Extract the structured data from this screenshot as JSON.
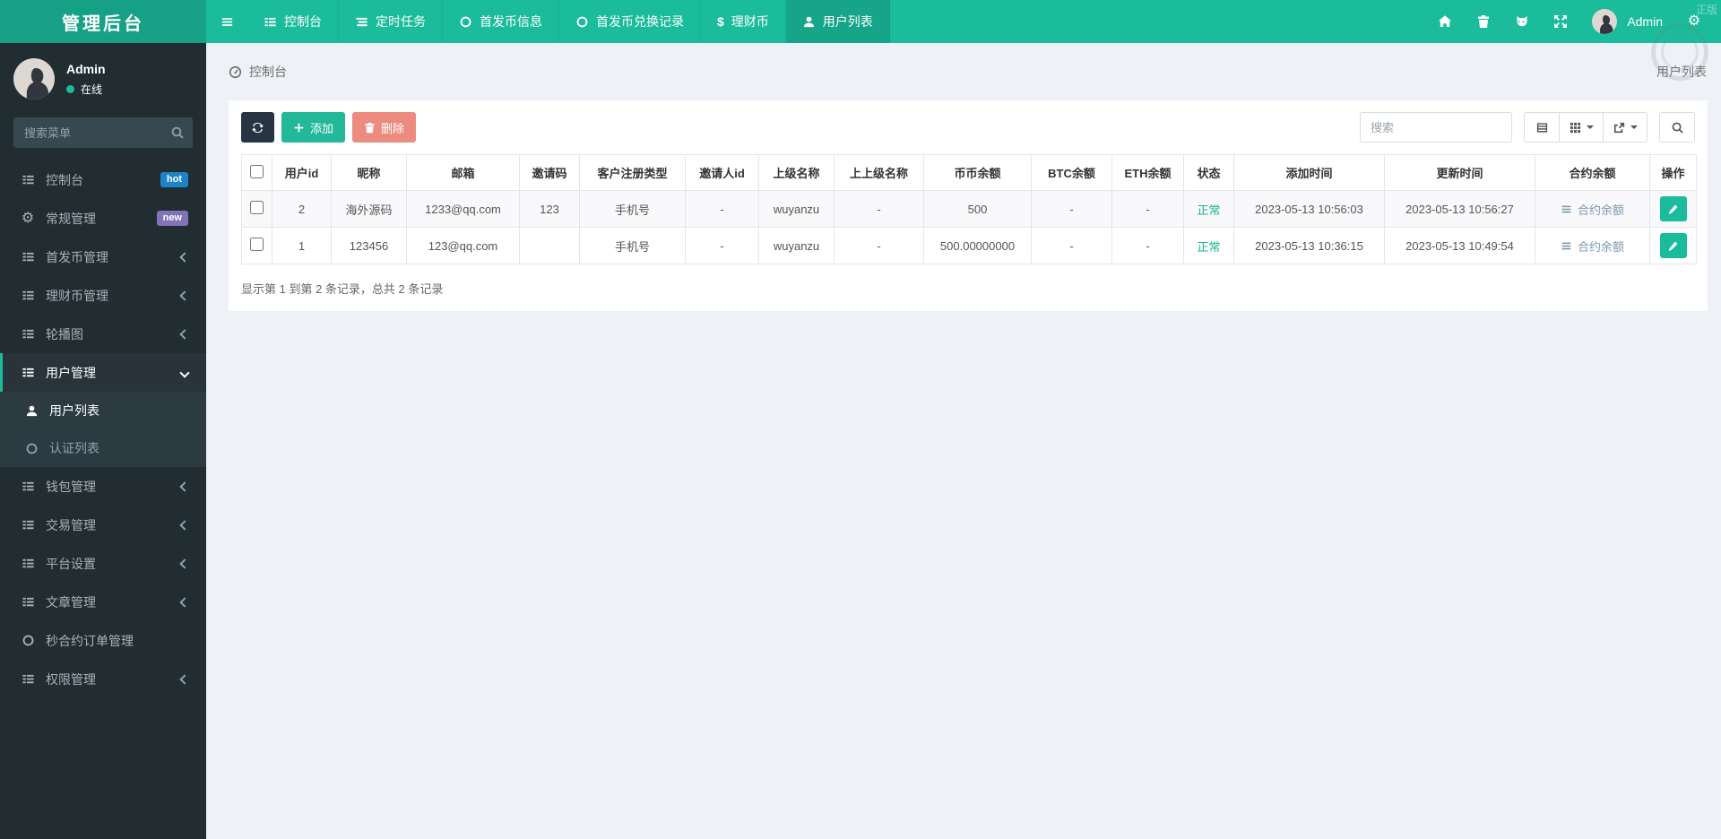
{
  "app": {
    "logo": "管理后台",
    "watermark": "正版"
  },
  "topnav": {
    "tabs": [
      {
        "label": "控制台",
        "icon": "thlist",
        "active": false
      },
      {
        "label": "定时任务",
        "icon": "tasks",
        "active": false
      },
      {
        "label": "首发币信息",
        "icon": "circle",
        "active": false
      },
      {
        "label": "首发币兑换记录",
        "icon": "circle",
        "active": false
      },
      {
        "label": "理财币",
        "icon": "dollar",
        "active": false
      },
      {
        "label": "用户列表",
        "icon": "user",
        "active": true
      }
    ],
    "right_icons": [
      "home",
      "trash",
      "cat",
      "expand"
    ],
    "admin_label": "Admin",
    "settings_icon": "cogs"
  },
  "sidebar": {
    "user": {
      "name": "Admin",
      "status": "在线"
    },
    "search_placeholder": "搜索菜单",
    "items": [
      {
        "label": "控制台",
        "icon": "thlist",
        "badge": {
          "text": "hot",
          "color": "#1c84c6"
        }
      },
      {
        "label": "常规管理",
        "icon": "cogs",
        "badge": {
          "text": "new",
          "color": "#8272b8"
        }
      },
      {
        "label": "首发币管理",
        "icon": "thlist",
        "chevron": "left"
      },
      {
        "label": "理财币管理",
        "icon": "thlist",
        "chevron": "left"
      },
      {
        "label": "轮播图",
        "icon": "thlist",
        "chevron": "left"
      },
      {
        "label": "用户管理",
        "icon": "thlist",
        "chevron": "down",
        "active": true,
        "children": [
          {
            "label": "用户列表",
            "icon": "user",
            "active": true
          },
          {
            "label": "认证列表",
            "icon": "circle",
            "active": false
          }
        ]
      },
      {
        "label": "钱包管理",
        "icon": "thlist",
        "chevron": "left"
      },
      {
        "label": "交易管理",
        "icon": "thlist",
        "chevron": "left"
      },
      {
        "label": "平台设置",
        "icon": "thlist",
        "chevron": "left"
      },
      {
        "label": "文章管理",
        "icon": "thlist",
        "chevron": "left"
      },
      {
        "label": "秒合约订单管理",
        "icon": "circle"
      },
      {
        "label": "权限管理",
        "icon": "thlist",
        "chevron": "left"
      }
    ]
  },
  "breadcrumb": {
    "left": "控制台",
    "right": "用户列表"
  },
  "toolbar": {
    "add_label": "添加",
    "delete_label": "删除",
    "search_placeholder": "搜索"
  },
  "table": {
    "columns": [
      "用户id",
      "昵称",
      "邮箱",
      "邀请码",
      "客户注册类型",
      "邀请人id",
      "上级名称",
      "上上级名称",
      "币币余额",
      "BTC余额",
      "ETH余额",
      "状态",
      "添加时间",
      "更新时间",
      "合约余额",
      "操作"
    ],
    "rows": [
      {
        "user_id": "2",
        "nickname": "海外源码",
        "email": "1233@qq.com",
        "invite_code": "123",
        "reg_type": "手机号",
        "inviter_id": "-",
        "parent_name": "wuyanzu",
        "grandparent_name": "-",
        "coin_balance": "500",
        "btc_balance": "-",
        "eth_balance": "-",
        "status": "正常",
        "created_at": "2023-05-13 10:56:03",
        "updated_at": "2023-05-13 10:56:27",
        "contract_label": "合约余额"
      },
      {
        "user_id": "1",
        "nickname": "123456",
        "email": "123@qq.com",
        "invite_code": "",
        "reg_type": "手机号",
        "inviter_id": "-",
        "parent_name": "wuyanzu",
        "grandparent_name": "-",
        "coin_balance": "500.00000000",
        "btc_balance": "-",
        "eth_balance": "-",
        "status": "正常",
        "created_at": "2023-05-13 10:36:15",
        "updated_at": "2023-05-13 10:49:54",
        "contract_label": "合约余额"
      }
    ],
    "summary": "显示第 1 到第 2 条记录，总共 2 条记录"
  },
  "colors": {
    "navbar": "#1abc9c",
    "navbar_dark": "#16a085",
    "sidebar": "#222d32",
    "sidebar_active": "#2c3b41",
    "badge_hot": "#1c84c6",
    "badge_new": "#8272b8",
    "btn_refresh": "#273444",
    "btn_add": "#23b899",
    "btn_delete": "#ec8b80",
    "status_ok": "#1ab394",
    "contract_link": "#7d97a8"
  }
}
